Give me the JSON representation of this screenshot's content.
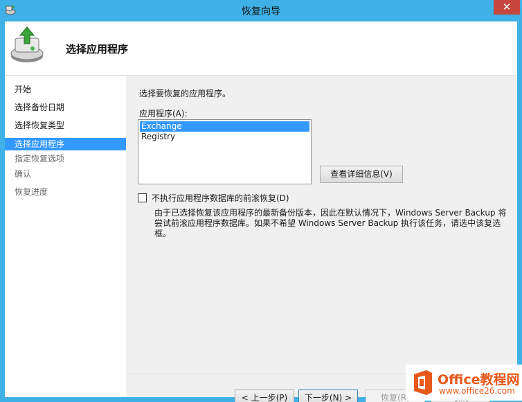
{
  "window": {
    "title": "恢复向导",
    "close_glyph": "✕"
  },
  "header": {
    "title": "选择应用程序",
    "icon": "backup-restore-icon"
  },
  "nav": {
    "items": [
      {
        "label": "开始",
        "state": "normal"
      },
      {
        "label": "选择备份日期",
        "state": "normal"
      },
      {
        "label": "选择恢复类型",
        "state": "normal"
      },
      {
        "label": "选择应用程序",
        "state": "active"
      },
      {
        "label": "指定恢复选项",
        "state": "disabled"
      },
      {
        "label": "确认",
        "state": "disabled"
      },
      {
        "label": "恢复进度",
        "state": "disabled"
      }
    ]
  },
  "main": {
    "instruction": "选择要恢复的应用程序。",
    "list_label": "应用程序(A):",
    "applications": [
      {
        "name": "Exchange",
        "selected": true
      },
      {
        "name": "Registry",
        "selected": false
      }
    ],
    "details_button": "查看详细信息(V)",
    "checkbox": {
      "label": "不执行应用程序数据库的前滚恢复(D)",
      "checked": false
    },
    "description": "由于已选择恢复该应用程序的最新备份版本，因此在默认情况下，Windows Server Backup 将尝试前滚应用程序数据库。如果不希望 Windows Server Backup 执行该任务，请选中该复选框。"
  },
  "footer": {
    "back": "< 上一步(P)",
    "next": "下一步(N) >",
    "recover": "恢复(R)",
    "cancel": "取消"
  },
  "watermark": {
    "title": "Office教程网",
    "url": "www.office26.com"
  },
  "colors": {
    "title_bar": "#3fb1e6",
    "selection": "#3399ff",
    "close": "#c7463e",
    "watermark": "#e8591a"
  }
}
